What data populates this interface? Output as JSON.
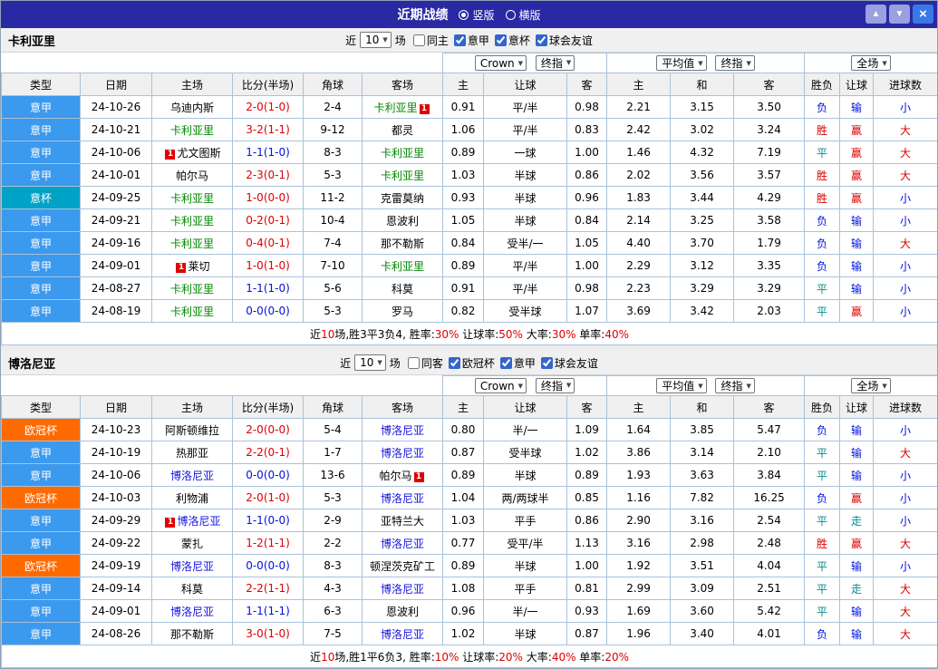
{
  "topbar": {
    "title": "近期战绩",
    "layout_options": [
      {
        "label": "竖版",
        "selected": true
      },
      {
        "label": "横版",
        "selected": false
      }
    ],
    "buttons": {
      "up": "▲",
      "down": "▼",
      "close": "×"
    }
  },
  "ui": {
    "select_arrow": "▼"
  },
  "colors": {
    "topbar": "#2929a3",
    "serie_a": "#3b99ee",
    "italy_cup": "#00a2c6",
    "ucl": "#ff6a00",
    "win": "#dd0000",
    "lose": "#0011dd",
    "draw": "#008b8b",
    "focus_green": "#008800",
    "focus_blue": "#1515e0",
    "grid": "#a9c2da",
    "header_bg": "#f0f0f0",
    "nav_btn": "#9aa0e0",
    "close_btn": "#3b78e7"
  },
  "sections": [
    {
      "team": "卡利亚里",
      "filter": {
        "prefix": "近",
        "count": "10",
        "suffix": "场",
        "checkboxes": [
          [
            "同主",
            false
          ],
          [
            "意甲",
            true
          ],
          [
            "意杯",
            true
          ],
          [
            "球会友谊",
            true
          ]
        ]
      },
      "dropdowns": {
        "handicap_company": "Crown",
        "handicap_time": "终指",
        "europe_company": "平均值",
        "europe_time": "终指",
        "scope": "全场"
      },
      "columns": [
        "类型",
        "日期",
        "主场",
        "比分(半场)",
        "角球",
        "客场",
        "主",
        "让球",
        "客",
        "主",
        "和",
        "客",
        "胜负",
        "让球",
        "进球数"
      ],
      "rows": [
        {
          "lg": "意甲",
          "lgc": "sa",
          "date": "24-10-26",
          "home": {
            "n": "乌迪内斯",
            "c": "k"
          },
          "score": {
            "t": "2-0(1-0)",
            "c": "r"
          },
          "corner": "2-4",
          "away": {
            "n": "卡利亚里",
            "c": "g",
            "badge": "1",
            "bpos": "after"
          },
          "odds": [
            "0.91",
            "平/半",
            "0.98",
            "2.21",
            "3.15",
            "3.50"
          ],
          "res": [
            [
              "负",
              "b"
            ],
            [
              "输",
              "b"
            ],
            [
              "小",
              "b"
            ]
          ]
        },
        {
          "lg": "意甲",
          "lgc": "sa",
          "date": "24-10-21",
          "home": {
            "n": "卡利亚里",
            "c": "g"
          },
          "score": {
            "t": "3-2(1-1)",
            "c": "r"
          },
          "corner": "9-12",
          "away": {
            "n": "都灵",
            "c": "k"
          },
          "odds": [
            "1.06",
            "平/半",
            "0.83",
            "2.42",
            "3.02",
            "3.24"
          ],
          "res": [
            [
              "胜",
              "r"
            ],
            [
              "赢",
              "r"
            ],
            [
              "大",
              "r"
            ]
          ]
        },
        {
          "lg": "意甲",
          "lgc": "sa",
          "date": "24-10-06",
          "home": {
            "n": "尤文图斯",
            "c": "k",
            "badge": "1",
            "bpos": "before"
          },
          "score": {
            "t": "1-1(1-0)",
            "c": "b"
          },
          "corner": "8-3",
          "away": {
            "n": "卡利亚里",
            "c": "g"
          },
          "odds": [
            "0.89",
            "一球",
            "1.00",
            "1.46",
            "4.32",
            "7.19"
          ],
          "res": [
            [
              "平",
              "t"
            ],
            [
              "赢",
              "r"
            ],
            [
              "大",
              "r"
            ]
          ]
        },
        {
          "lg": "意甲",
          "lgc": "sa",
          "date": "24-10-01",
          "home": {
            "n": "帕尔马",
            "c": "k"
          },
          "score": {
            "t": "2-3(0-1)",
            "c": "r"
          },
          "corner": "5-3",
          "away": {
            "n": "卡利亚里",
            "c": "g"
          },
          "odds": [
            "1.03",
            "半球",
            "0.86",
            "2.02",
            "3.56",
            "3.57"
          ],
          "res": [
            [
              "胜",
              "r"
            ],
            [
              "赢",
              "r"
            ],
            [
              "大",
              "r"
            ]
          ]
        },
        {
          "lg": "意杯",
          "lgc": "cup",
          "date": "24-09-25",
          "home": {
            "n": "卡利亚里",
            "c": "g"
          },
          "score": {
            "t": "1-0(0-0)",
            "c": "r"
          },
          "corner": "11-2",
          "away": {
            "n": "克雷莫纳",
            "c": "k"
          },
          "odds": [
            "0.93",
            "半球",
            "0.96",
            "1.83",
            "3.44",
            "4.29"
          ],
          "res": [
            [
              "胜",
              "r"
            ],
            [
              "赢",
              "r"
            ],
            [
              "小",
              "b"
            ]
          ]
        },
        {
          "lg": "意甲",
          "lgc": "sa",
          "date": "24-09-21",
          "home": {
            "n": "卡利亚里",
            "c": "g"
          },
          "score": {
            "t": "0-2(0-1)",
            "c": "r"
          },
          "corner": "10-4",
          "away": {
            "n": "恩波利",
            "c": "k"
          },
          "odds": [
            "1.05",
            "半球",
            "0.84",
            "2.14",
            "3.25",
            "3.58"
          ],
          "res": [
            [
              "负",
              "b"
            ],
            [
              "输",
              "b"
            ],
            [
              "小",
              "b"
            ]
          ]
        },
        {
          "lg": "意甲",
          "lgc": "sa",
          "date": "24-09-16",
          "home": {
            "n": "卡利亚里",
            "c": "g"
          },
          "score": {
            "t": "0-4(0-1)",
            "c": "r"
          },
          "corner": "7-4",
          "away": {
            "n": "那不勒斯",
            "c": "k"
          },
          "odds": [
            "0.84",
            "受半/一",
            "1.05",
            "4.40",
            "3.70",
            "1.79"
          ],
          "res": [
            [
              "负",
              "b"
            ],
            [
              "输",
              "b"
            ],
            [
              "大",
              "r"
            ]
          ]
        },
        {
          "lg": "意甲",
          "lgc": "sa",
          "date": "24-09-01",
          "home": {
            "n": "莱切",
            "c": "k",
            "badge": "1",
            "bpos": "before"
          },
          "score": {
            "t": "1-0(1-0)",
            "c": "r"
          },
          "corner": "7-10",
          "away": {
            "n": "卡利亚里",
            "c": "g"
          },
          "odds": [
            "0.89",
            "平/半",
            "1.00",
            "2.29",
            "3.12",
            "3.35"
          ],
          "res": [
            [
              "负",
              "b"
            ],
            [
              "输",
              "b"
            ],
            [
              "小",
              "b"
            ]
          ]
        },
        {
          "lg": "意甲",
          "lgc": "sa",
          "date": "24-08-27",
          "home": {
            "n": "卡利亚里",
            "c": "g"
          },
          "score": {
            "t": "1-1(1-0)",
            "c": "b"
          },
          "corner": "5-6",
          "away": {
            "n": "科莫",
            "c": "k"
          },
          "odds": [
            "0.91",
            "平/半",
            "0.98",
            "2.23",
            "3.29",
            "3.29"
          ],
          "res": [
            [
              "平",
              "t"
            ],
            [
              "输",
              "b"
            ],
            [
              "小",
              "b"
            ]
          ]
        },
        {
          "lg": "意甲",
          "lgc": "sa",
          "date": "24-08-19",
          "home": {
            "n": "卡利亚里",
            "c": "g"
          },
          "score": {
            "t": "0-0(0-0)",
            "c": "b"
          },
          "corner": "5-3",
          "away": {
            "n": "罗马",
            "c": "k"
          },
          "odds": [
            "0.82",
            "受半球",
            "1.07",
            "3.69",
            "3.42",
            "2.03"
          ],
          "res": [
            [
              "平",
              "t"
            ],
            [
              "赢",
              "r"
            ],
            [
              "小",
              "b"
            ]
          ]
        }
      ],
      "summary": [
        [
          "近",
          "k"
        ],
        [
          "10",
          "r"
        ],
        [
          "场,胜3平3负4, 胜率:",
          "k"
        ],
        [
          "30%",
          "r"
        ],
        [
          " 让球率:",
          "k"
        ],
        [
          "50%",
          "r"
        ],
        [
          " 大率:",
          "k"
        ],
        [
          "30%",
          "r"
        ],
        [
          " 单率:",
          "k"
        ],
        [
          "40%",
          "r"
        ]
      ]
    },
    {
      "team": "博洛尼亚",
      "filter": {
        "prefix": "近",
        "count": "10",
        "suffix": "场",
        "checkboxes": [
          [
            "同客",
            false
          ],
          [
            "欧冠杯",
            true
          ],
          [
            "意甲",
            true
          ],
          [
            "球会友谊",
            true
          ]
        ]
      },
      "dropdowns": {
        "handicap_company": "Crown",
        "handicap_time": "终指",
        "europe_company": "平均值",
        "europe_time": "终指",
        "scope": "全场"
      },
      "columns": [
        "类型",
        "日期",
        "主场",
        "比分(半场)",
        "角球",
        "客场",
        "主",
        "让球",
        "客",
        "主",
        "和",
        "客",
        "胜负",
        "让球",
        "进球数"
      ],
      "rows": [
        {
          "lg": "欧冠杯",
          "lgc": "ucl",
          "date": "24-10-23",
          "home": {
            "n": "阿斯顿维拉",
            "c": "k"
          },
          "score": {
            "t": "2-0(0-0)",
            "c": "r"
          },
          "corner": "5-4",
          "away": {
            "n": "博洛尼亚",
            "c": "u"
          },
          "odds": [
            "0.80",
            "半/一",
            "1.09",
            "1.64",
            "3.85",
            "5.47"
          ],
          "res": [
            [
              "负",
              "b"
            ],
            [
              "输",
              "b"
            ],
            [
              "小",
              "b"
            ]
          ]
        },
        {
          "lg": "意甲",
          "lgc": "sa",
          "date": "24-10-19",
          "home": {
            "n": "热那亚",
            "c": "k"
          },
          "score": {
            "t": "2-2(0-1)",
            "c": "r"
          },
          "corner": "1-7",
          "away": {
            "n": "博洛尼亚",
            "c": "u"
          },
          "odds": [
            "0.87",
            "受半球",
            "1.02",
            "3.86",
            "3.14",
            "2.10"
          ],
          "res": [
            [
              "平",
              "t"
            ],
            [
              "输",
              "b"
            ],
            [
              "大",
              "r"
            ]
          ]
        },
        {
          "lg": "意甲",
          "lgc": "sa",
          "date": "24-10-06",
          "home": {
            "n": "博洛尼亚",
            "c": "u"
          },
          "score": {
            "t": "0-0(0-0)",
            "c": "b"
          },
          "corner": "13-6",
          "away": {
            "n": "帕尔马",
            "c": "k",
            "badge": "1",
            "bpos": "after"
          },
          "odds": [
            "0.89",
            "半球",
            "0.89",
            "1.93",
            "3.63",
            "3.84"
          ],
          "res": [
            [
              "平",
              "t"
            ],
            [
              "输",
              "b"
            ],
            [
              "小",
              "b"
            ]
          ]
        },
        {
          "lg": "欧冠杯",
          "lgc": "ucl",
          "date": "24-10-03",
          "home": {
            "n": "利物浦",
            "c": "k"
          },
          "score": {
            "t": "2-0(1-0)",
            "c": "r"
          },
          "corner": "5-3",
          "away": {
            "n": "博洛尼亚",
            "c": "u"
          },
          "odds": [
            "1.04",
            "两/两球半",
            "0.85",
            "1.16",
            "7.82",
            "16.25"
          ],
          "res": [
            [
              "负",
              "b"
            ],
            [
              "赢",
              "r"
            ],
            [
              "小",
              "b"
            ]
          ]
        },
        {
          "lg": "意甲",
          "lgc": "sa",
          "date": "24-09-29",
          "home": {
            "n": "博洛尼亚",
            "c": "u",
            "badge": "1",
            "bpos": "before"
          },
          "score": {
            "t": "1-1(0-0)",
            "c": "b"
          },
          "corner": "2-9",
          "away": {
            "n": "亚特兰大",
            "c": "k"
          },
          "odds": [
            "1.03",
            "平手",
            "0.86",
            "2.90",
            "3.16",
            "2.54"
          ],
          "res": [
            [
              "平",
              "t"
            ],
            [
              "走",
              "t"
            ],
            [
              "小",
              "b"
            ]
          ]
        },
        {
          "lg": "意甲",
          "lgc": "sa",
          "date": "24-09-22",
          "home": {
            "n": "蒙扎",
            "c": "k"
          },
          "score": {
            "t": "1-2(1-1)",
            "c": "r"
          },
          "corner": "2-2",
          "away": {
            "n": "博洛尼亚",
            "c": "u"
          },
          "odds": [
            "0.77",
            "受平/半",
            "1.13",
            "3.16",
            "2.98",
            "2.48"
          ],
          "res": [
            [
              "胜",
              "r"
            ],
            [
              "赢",
              "r"
            ],
            [
              "大",
              "r"
            ]
          ]
        },
        {
          "lg": "欧冠杯",
          "lgc": "ucl",
          "date": "24-09-19",
          "home": {
            "n": "博洛尼亚",
            "c": "u"
          },
          "score": {
            "t": "0-0(0-0)",
            "c": "b"
          },
          "corner": "8-3",
          "away": {
            "n": "顿涅茨克矿工",
            "c": "k"
          },
          "odds": [
            "0.89",
            "半球",
            "1.00",
            "1.92",
            "3.51",
            "4.04"
          ],
          "res": [
            [
              "平",
              "t"
            ],
            [
              "输",
              "b"
            ],
            [
              "小",
              "b"
            ]
          ]
        },
        {
          "lg": "意甲",
          "lgc": "sa",
          "date": "24-09-14",
          "home": {
            "n": "科莫",
            "c": "k"
          },
          "score": {
            "t": "2-2(1-1)",
            "c": "r"
          },
          "corner": "4-3",
          "away": {
            "n": "博洛尼亚",
            "c": "u"
          },
          "odds": [
            "1.08",
            "平手",
            "0.81",
            "2.99",
            "3.09",
            "2.51"
          ],
          "res": [
            [
              "平",
              "t"
            ],
            [
              "走",
              "t"
            ],
            [
              "大",
              "r"
            ]
          ]
        },
        {
          "lg": "意甲",
          "lgc": "sa",
          "date": "24-09-01",
          "home": {
            "n": "博洛尼亚",
            "c": "u"
          },
          "score": {
            "t": "1-1(1-1)",
            "c": "b"
          },
          "corner": "6-3",
          "away": {
            "n": "恩波利",
            "c": "k"
          },
          "odds": [
            "0.96",
            "半/一",
            "0.93",
            "1.69",
            "3.60",
            "5.42"
          ],
          "res": [
            [
              "平",
              "t"
            ],
            [
              "输",
              "b"
            ],
            [
              "大",
              "r"
            ]
          ]
        },
        {
          "lg": "意甲",
          "lgc": "sa",
          "date": "24-08-26",
          "home": {
            "n": "那不勒斯",
            "c": "k"
          },
          "score": {
            "t": "3-0(1-0)",
            "c": "r"
          },
          "corner": "7-5",
          "away": {
            "n": "博洛尼亚",
            "c": "u"
          },
          "odds": [
            "1.02",
            "半球",
            "0.87",
            "1.96",
            "3.40",
            "4.01"
          ],
          "res": [
            [
              "负",
              "b"
            ],
            [
              "输",
              "b"
            ],
            [
              "大",
              "r"
            ]
          ]
        }
      ],
      "summary": [
        [
          "近",
          "k"
        ],
        [
          "10",
          "r"
        ],
        [
          "场,胜1平6负3, 胜率:",
          "k"
        ],
        [
          "10%",
          "r"
        ],
        [
          " 让球率:",
          "k"
        ],
        [
          "20%",
          "r"
        ],
        [
          " 大率:",
          "k"
        ],
        [
          "40%",
          "r"
        ],
        [
          " 单率:",
          "k"
        ],
        [
          "20%",
          "r"
        ]
      ]
    }
  ]
}
